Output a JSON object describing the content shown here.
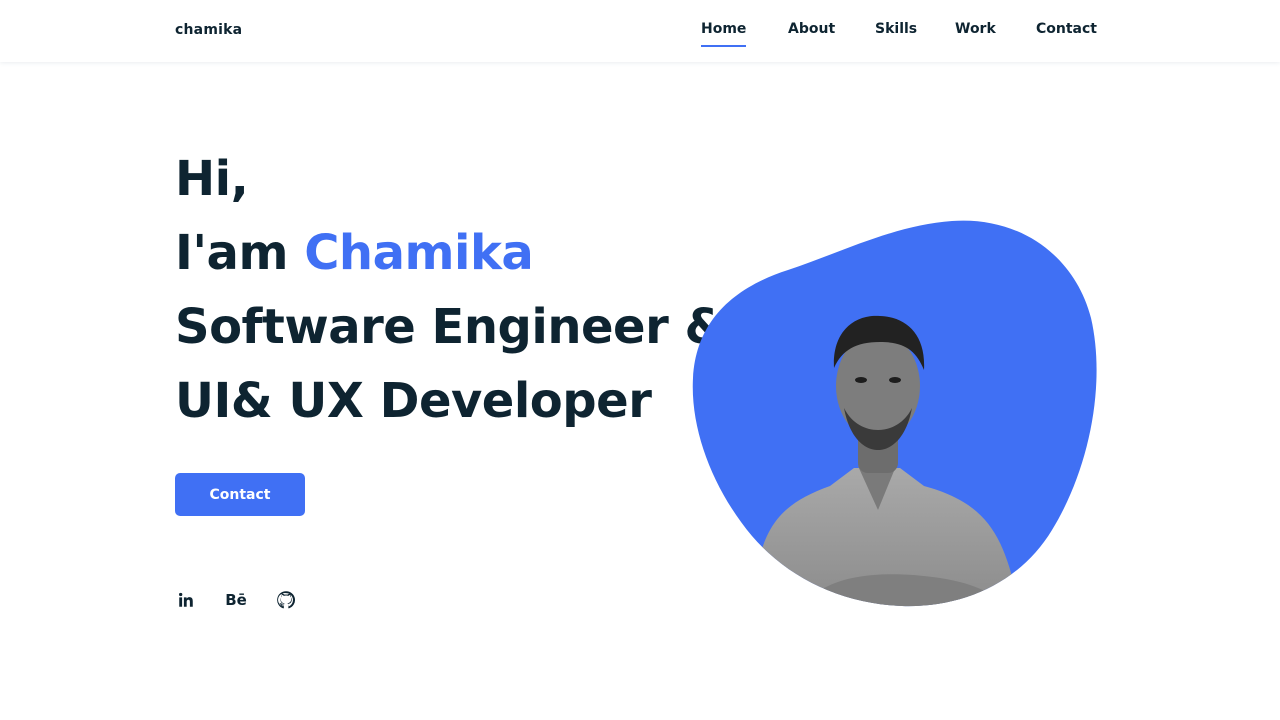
{
  "header": {
    "logo": "chamika",
    "nav": [
      {
        "label": "Home",
        "active": true
      },
      {
        "label": "About",
        "active": false
      },
      {
        "label": "Skills",
        "active": false
      },
      {
        "label": "Work",
        "active": false
      },
      {
        "label": "Contact",
        "active": false
      }
    ]
  },
  "hero": {
    "greeting": "Hi,",
    "intro_prefix": "I'am",
    "name": "Chamika",
    "role_line1": "Software Engineer &",
    "role_line2": "UI& UX Developer",
    "cta_label": "Contact"
  },
  "socials": [
    {
      "icon": "linkedin-icon"
    },
    {
      "icon": "behance-icon",
      "glyph": "Bē"
    },
    {
      "icon": "github-icon"
    }
  ],
  "colors": {
    "accent": "#4070f4",
    "text": "#0e2431",
    "background": "#ffffff"
  }
}
